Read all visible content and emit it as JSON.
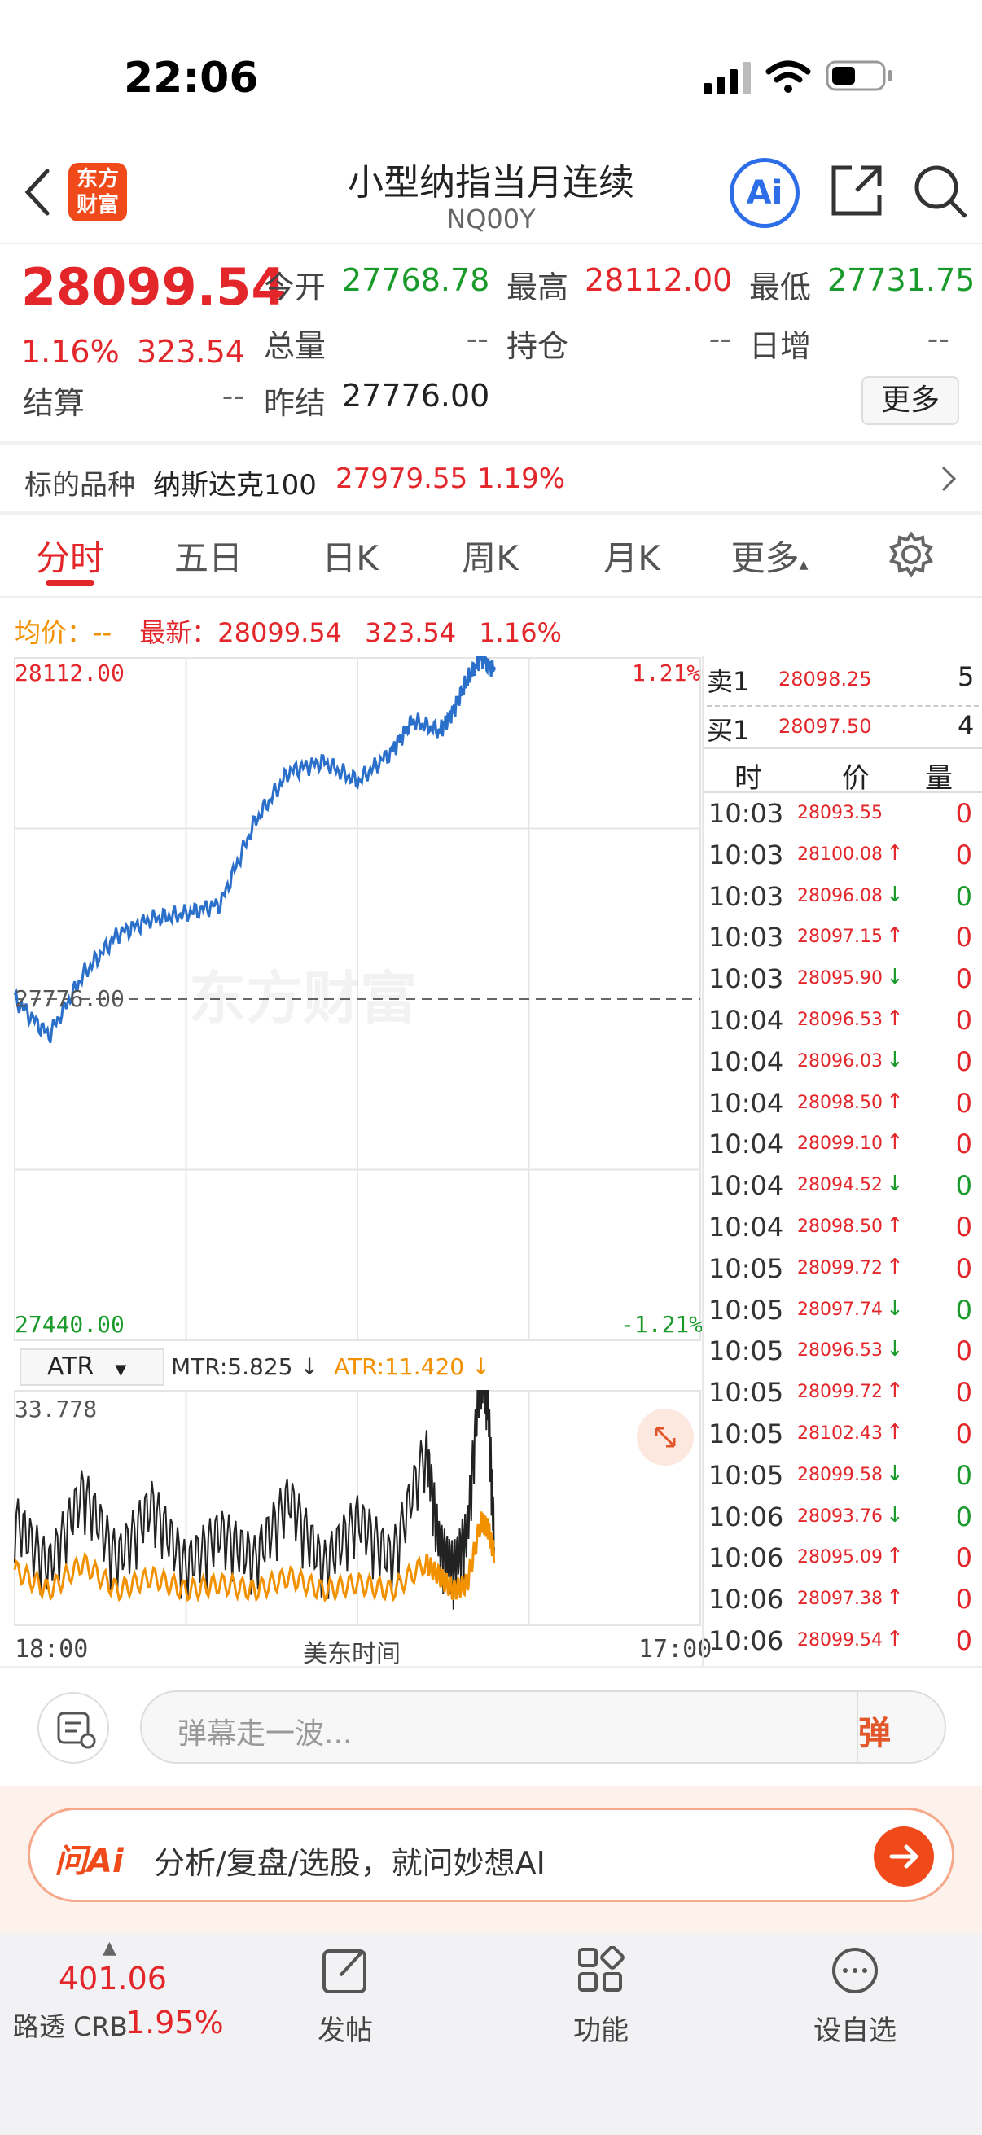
{
  "status": {
    "time": "22:06"
  },
  "header": {
    "logo": "东方\n财富",
    "title": "小型纳指当月连续",
    "code": "NQ00Y",
    "ai": "Ai"
  },
  "quote": {
    "price": "28099.54",
    "pct": "1.16%",
    "chg": "323.54",
    "fields": [
      {
        "label": "今开",
        "value": "27768.78",
        "color": "green"
      },
      {
        "label": "最高",
        "value": "28112.00",
        "color": "red"
      },
      {
        "label": "最低",
        "value": "27731.75",
        "color": "green"
      },
      {
        "label": "总量",
        "value": "--",
        "color": "gray"
      },
      {
        "label": "持仓",
        "value": "--",
        "color": "gray"
      },
      {
        "label": "日增",
        "value": "--",
        "color": "gray"
      },
      {
        "label": "结算",
        "value": "--",
        "color": "gray"
      },
      {
        "label": "昨结",
        "value": "27776.00",
        "color": "dark"
      }
    ],
    "more": "更多"
  },
  "underlying": {
    "label": "标的品种",
    "name": "纳斯达克100",
    "price": "27979.55",
    "pct": "1.19%"
  },
  "tabs": [
    "分时",
    "五日",
    "日K",
    "周K",
    "月K",
    "更多"
  ],
  "line_info": {
    "avg_label": "均价：",
    "avg": "--",
    "latest_label": "最新：",
    "latest": "28099.54",
    "chg": "323.54",
    "pct": "1.16%"
  },
  "chart_data": [
    {
      "type": "line",
      "title": "",
      "ylim": [
        27440.0,
        28112.0
      ],
      "ytick_left": [
        "28112.00",
        "27776.00",
        "27440.00"
      ],
      "ytick_right": [
        "1.21%",
        "-1.21%"
      ],
      "xlabels": [
        "18:00",
        "美东时间",
        "17:00"
      ],
      "series": [
        {
          "x": [
            0,
            0.05,
            0.1,
            0.15,
            0.2,
            0.25,
            0.3,
            0.35,
            0.4,
            0.45,
            0.5,
            0.55,
            0.58,
            0.62,
            0.64,
            0.66,
            0.68,
            0.7
          ],
          "values": [
            27776,
            27740,
            27800,
            27840,
            27855,
            27860,
            27870,
            27950,
            28000,
            28010,
            27990,
            28020,
            28050,
            28040,
            28060,
            28090,
            28112,
            28100
          ]
        }
      ],
      "watermark": "东方财富",
      "baseline": "27776.00"
    },
    {
      "type": "line",
      "title": "",
      "indicator": "ATR",
      "mtr_label": "MTR:5.825 ↓",
      "atr_label": "ATR:11.420 ↓",
      "ymax_label": "33.778",
      "ylim": [
        0,
        33.778
      ],
      "series": [
        {
          "name": "MTR",
          "color": "#222",
          "x": [
            0,
            0.05,
            0.1,
            0.15,
            0.2,
            0.25,
            0.3,
            0.35,
            0.4,
            0.45,
            0.5,
            0.55,
            0.6,
            0.62,
            0.64,
            0.66,
            0.68,
            0.69,
            0.7
          ],
          "values": [
            12,
            5,
            16,
            6,
            14,
            5,
            10,
            6,
            15,
            5,
            12,
            6,
            22,
            8,
            5,
            10,
            34,
            30,
            8
          ]
        },
        {
          "name": "ATR",
          "color": "#f29100",
          "x": [
            0,
            0.05,
            0.1,
            0.15,
            0.2,
            0.25,
            0.3,
            0.35,
            0.4,
            0.45,
            0.5,
            0.55,
            0.6,
            0.62,
            0.64,
            0.66,
            0.68,
            0.69,
            0.7
          ],
          "values": [
            8,
            5,
            9,
            5,
            7,
            5,
            6,
            5,
            7,
            5,
            6,
            5,
            9,
            7,
            5,
            6,
            15,
            14,
            10
          ]
        }
      ]
    }
  ],
  "orderbook": {
    "sell_label": "卖1",
    "sell_price": "28098.25",
    "sell_vol": "5",
    "buy_label": "买1",
    "buy_price": "28097.50",
    "buy_vol": "4",
    "headers": [
      "时",
      "价",
      "量"
    ],
    "ticks": [
      {
        "t": "10:03",
        "p": "28093.55",
        "d": "",
        "v": "0",
        "c": "red"
      },
      {
        "t": "10:03",
        "p": "28100.08",
        "d": "↑",
        "v": "0",
        "c": "red"
      },
      {
        "t": "10:03",
        "p": "28096.08",
        "d": "↓",
        "v": "0",
        "c": "green"
      },
      {
        "t": "10:03",
        "p": "28097.15",
        "d": "↑",
        "v": "0",
        "c": "red"
      },
      {
        "t": "10:03",
        "p": "28095.90",
        "d": "↓",
        "v": "0",
        "c": "red"
      },
      {
        "t": "10:04",
        "p": "28096.53",
        "d": "↑",
        "v": "0",
        "c": "red"
      },
      {
        "t": "10:04",
        "p": "28096.03",
        "d": "↓",
        "v": "0",
        "c": "red"
      },
      {
        "t": "10:04",
        "p": "28098.50",
        "d": "↑",
        "v": "0",
        "c": "red"
      },
      {
        "t": "10:04",
        "p": "28099.10",
        "d": "↑",
        "v": "0",
        "c": "red"
      },
      {
        "t": "10:04",
        "p": "28094.52",
        "d": "↓",
        "v": "0",
        "c": "green"
      },
      {
        "t": "10:04",
        "p": "28098.50",
        "d": "↑",
        "v": "0",
        "c": "red"
      },
      {
        "t": "10:05",
        "p": "28099.72",
        "d": "↑",
        "v": "0",
        "c": "red"
      },
      {
        "t": "10:05",
        "p": "28097.74",
        "d": "↓",
        "v": "0",
        "c": "green"
      },
      {
        "t": "10:05",
        "p": "28096.53",
        "d": "↓",
        "v": "0",
        "c": "red"
      },
      {
        "t": "10:05",
        "p": "28099.72",
        "d": "↑",
        "v": "0",
        "c": "red"
      },
      {
        "t": "10:05",
        "p": "28102.43",
        "d": "↑",
        "v": "0",
        "c": "red"
      },
      {
        "t": "10:05",
        "p": "28099.58",
        "d": "↓",
        "v": "0",
        "c": "green"
      },
      {
        "t": "10:06",
        "p": "28093.76",
        "d": "↓",
        "v": "0",
        "c": "green"
      },
      {
        "t": "10:06",
        "p": "28095.09",
        "d": "↑",
        "v": "0",
        "c": "red"
      },
      {
        "t": "10:06",
        "p": "28097.38",
        "d": "↑",
        "v": "0",
        "c": "red"
      },
      {
        "t": "10:06",
        "p": "28099.54",
        "d": "↑",
        "v": "0",
        "c": "red"
      }
    ]
  },
  "danmu": {
    "placeholder": "弹幕走一波...",
    "btn": "弹"
  },
  "askai": {
    "logo": "问Ai",
    "text": "分析/复盘/选股，就问妙想AI"
  },
  "bottom": {
    "crb_val": "401.06",
    "crb_label": "路透 CRB",
    "crb_pct": "1.95%",
    "post": "发帖",
    "func": "功能",
    "watch": "设自选"
  }
}
